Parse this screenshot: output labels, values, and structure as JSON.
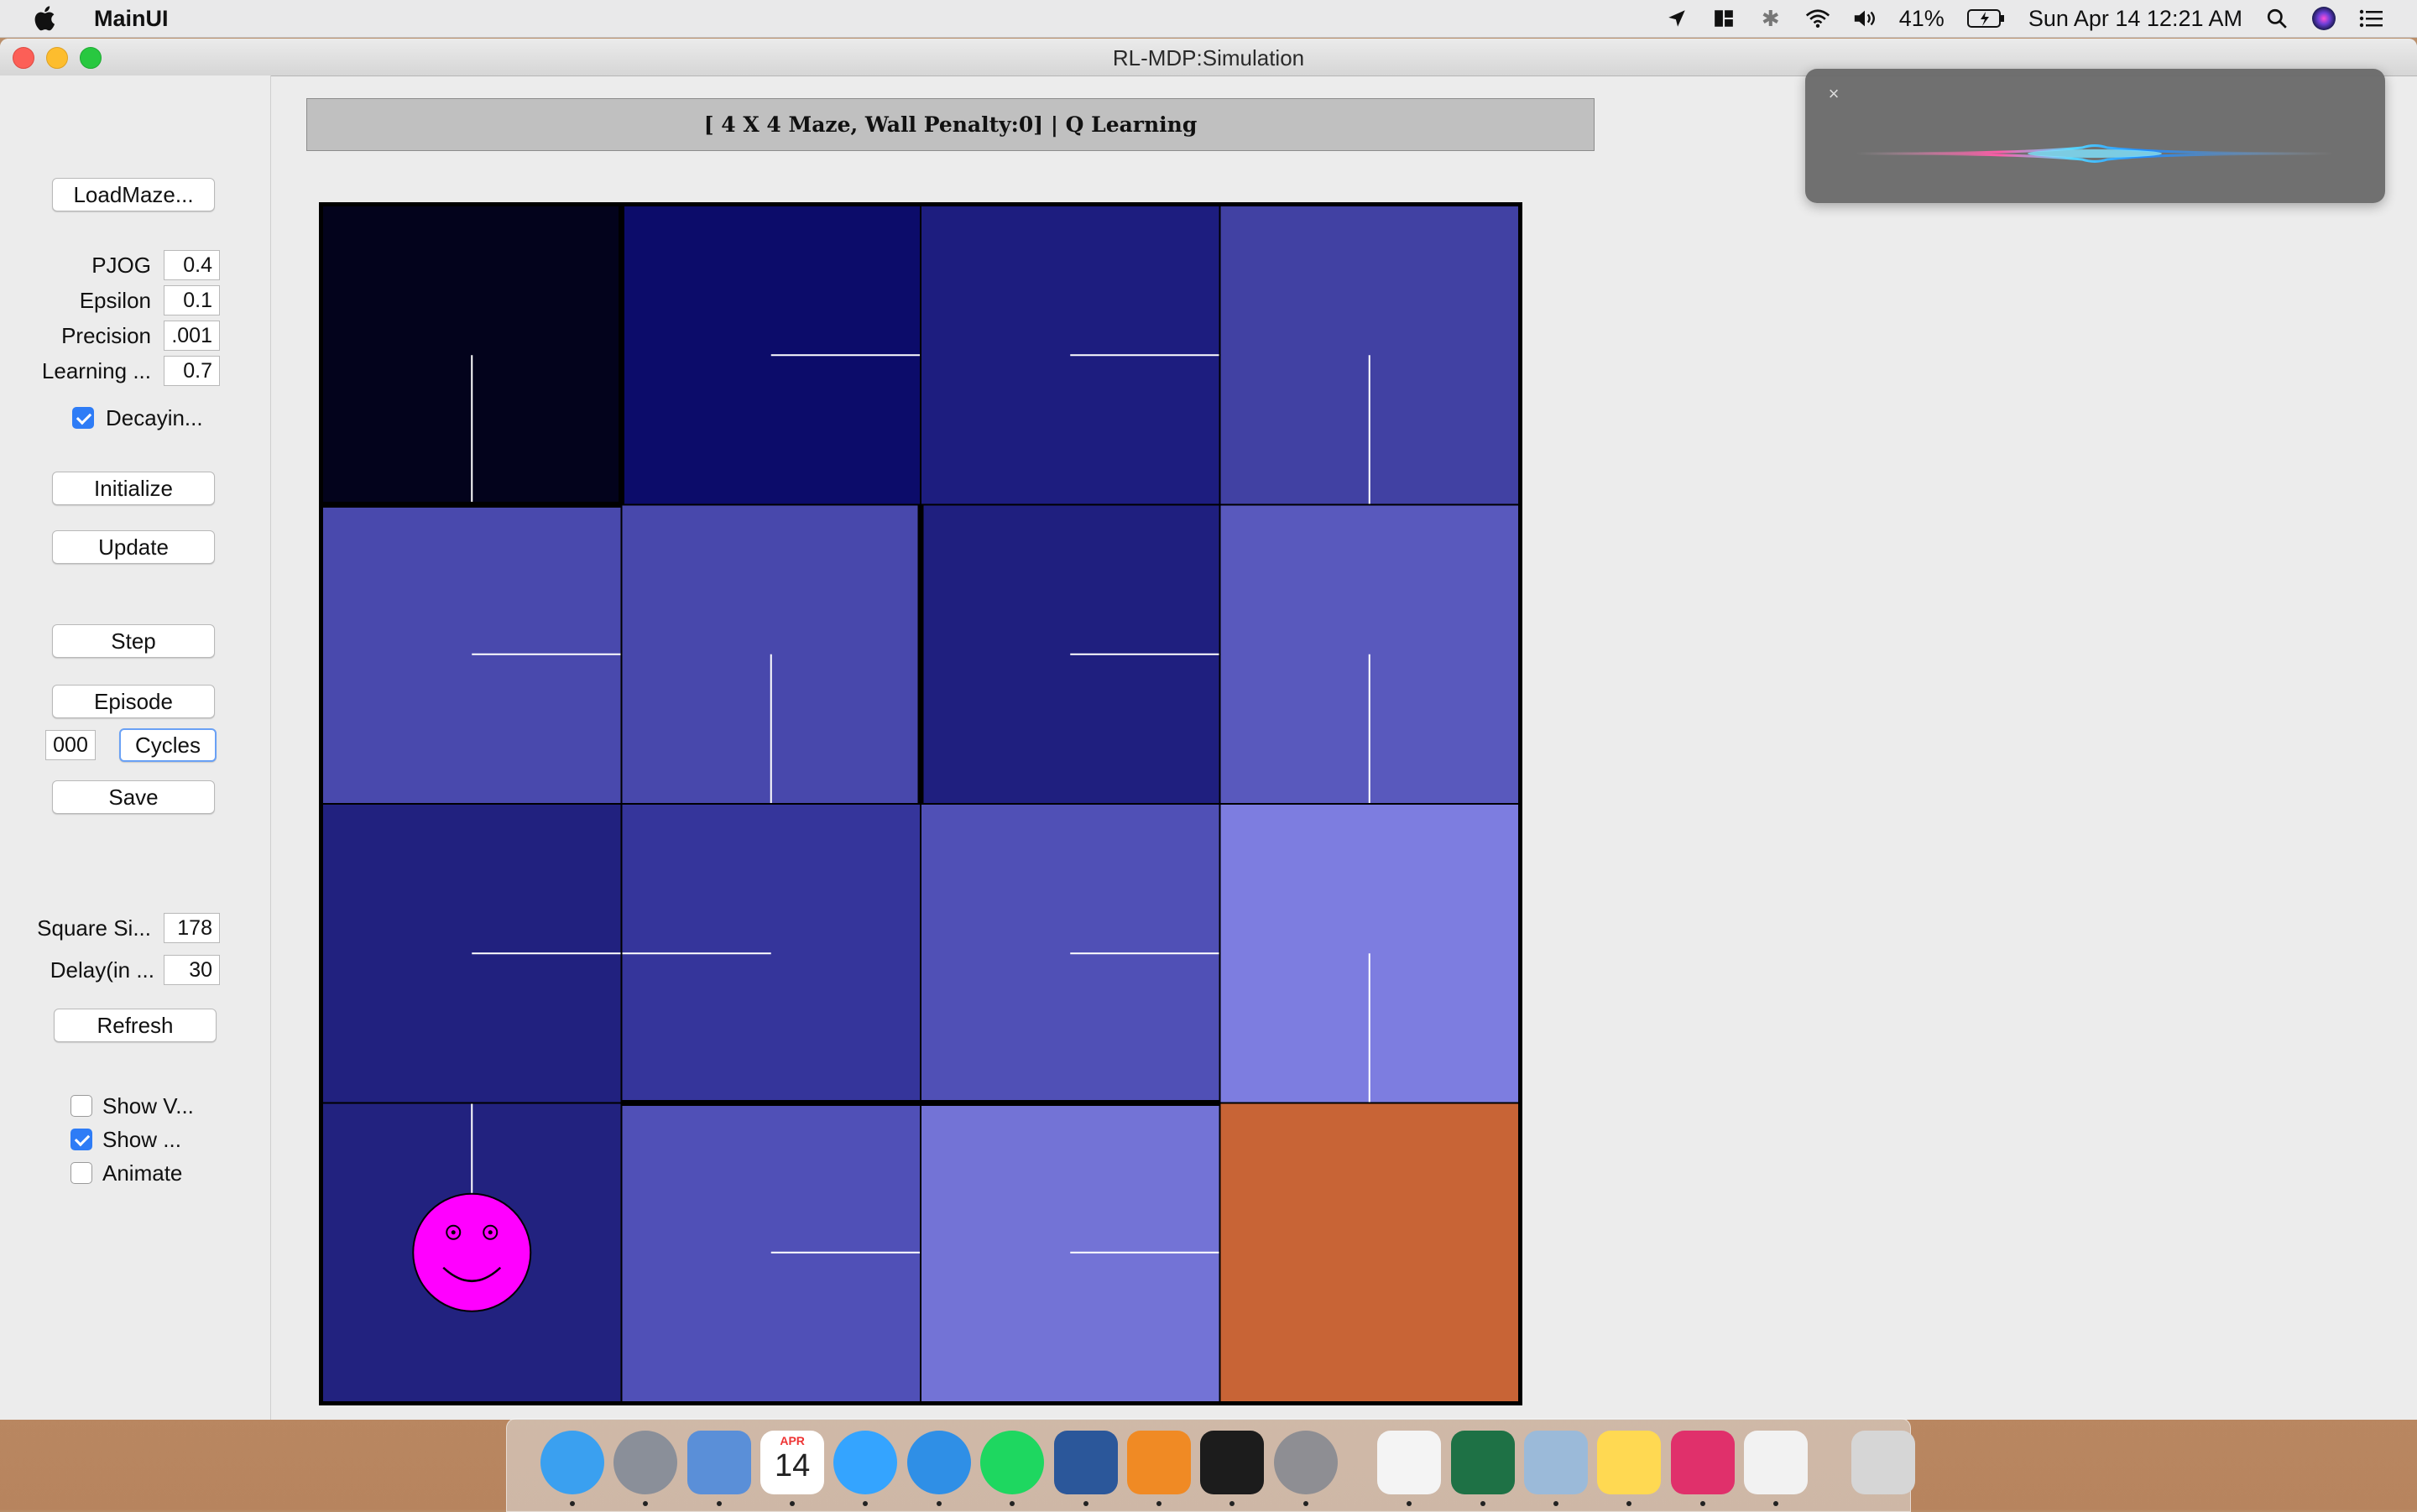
{
  "menubar": {
    "app_name": "MainUI",
    "battery": "41%",
    "clock": "Sun Apr 14  12:21 AM",
    "icons": [
      "apple-icon",
      "location-icon",
      "tile-icon",
      "bluetooth-icon",
      "wifi-icon",
      "volume-icon",
      "battery-icon",
      "search-icon",
      "siri-icon",
      "list-icon"
    ]
  },
  "window": {
    "title": "RL-MDP:Simulation"
  },
  "panel": {
    "load_maze": "LoadMaze...",
    "params": [
      {
        "label": "PJOG",
        "value": "0.4"
      },
      {
        "label": "Epsilon",
        "value": "0.1"
      },
      {
        "label": "Precision",
        "value": ".001"
      },
      {
        "label": "Learning ...",
        "value": "0.7"
      }
    ],
    "decaying_label": "Decayin...",
    "decaying_checked": true,
    "initialize": "Initialize",
    "update": "Update",
    "step": "Step",
    "episode": "Episode",
    "cycles_count": "000",
    "cycles": "Cycles",
    "save": "Save",
    "square_size_label": "Square Si...",
    "square_size_value": "178",
    "delay_label": "Delay(in ...",
    "delay_value": "30",
    "refresh": "Refresh",
    "show_v_label": "Show V...",
    "show_v_checked": false,
    "show_label": "Show ...",
    "show_checked": true,
    "animate_label": "Animate",
    "animate_checked": false
  },
  "header": {
    "text": "[ 4 X 4 Maze, Wall Penalty:0] |  Q Learning"
  },
  "maze": {
    "rows": 4,
    "cols": 4,
    "cell_colors": [
      [
        "#03031c",
        "#0c0c6a",
        "#1d1d7f",
        "#4141a3"
      ],
      [
        "#4949ad",
        "#4848ac",
        "#1f1f7f",
        "#5959bd"
      ],
      [
        "#21217f",
        "#35359b",
        "#5050b6",
        "#7d7de0"
      ],
      [
        "#22227f",
        "#5050b7",
        "#7373d6",
        "#c86436"
      ]
    ],
    "policy": [
      [
        "S",
        "E",
        "E",
        "S"
      ],
      [
        "E",
        "S",
        "E",
        "S"
      ],
      [
        "E",
        "W",
        "E",
        "S"
      ],
      [
        "N",
        "E",
        "E",
        ""
      ]
    ],
    "goal_cell": [
      3,
      3
    ],
    "agent_cell": [
      3,
      0
    ],
    "agent_color": "#ff00ff"
  },
  "siri": {
    "close": "×"
  },
  "dock": {
    "apps": [
      "finder-icon",
      "launchpad-icon",
      "mail-icon",
      "calendar-icon",
      "messages-icon",
      "safari-icon",
      "spotify-icon",
      "word-icon",
      "sublime-icon",
      "terminal-icon",
      "system-preferences-icon",
      "textedit-icon",
      "excel-icon",
      "preview-icon",
      "notes-icon",
      "intellij-icon",
      "java-icon",
      "trash-icon"
    ],
    "calendar_month": "APR",
    "calendar_day": "14"
  }
}
